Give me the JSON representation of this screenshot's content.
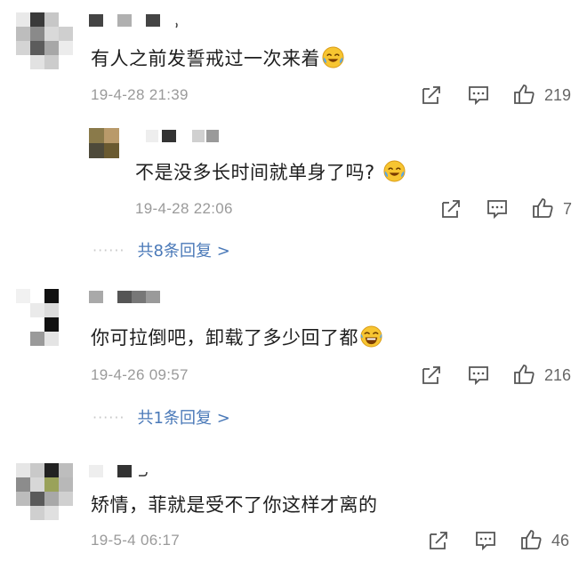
{
  "comments": [
    {
      "text": "有人之前发誓戒过一次来着",
      "time": "19-4-28 21:39",
      "likes": "219",
      "emoji": "crying-laughing-emoji",
      "reply": {
        "text": "不是没多长时间就单身了吗?",
        "time": "19-4-28 22:06",
        "likes": "7",
        "emoji": "crying-laughing-emoji"
      },
      "replies_link": {
        "dots": "······",
        "label": "共8条回复 >"
      }
    },
    {
      "text": "你可拉倒吧，卸载了多少回了都",
      "time": "19-4-26 09:57",
      "likes": "216",
      "emoji": "laughing-emoji",
      "replies_link": {
        "dots": "······",
        "label": "共1条回复 >"
      }
    },
    {
      "text": "矫情，菲就是受不了你这样才离的",
      "time": "19-5-4 06:17",
      "likes": "46"
    }
  ],
  "icons": {
    "share": "share-icon",
    "comment": "comment-icon",
    "like": "thumbs-up-icon"
  },
  "colors": {
    "link": "#4a79b8",
    "meta": "#9a9a9a",
    "text": "#1e1e1e",
    "emoji_face": "#f7c531"
  }
}
